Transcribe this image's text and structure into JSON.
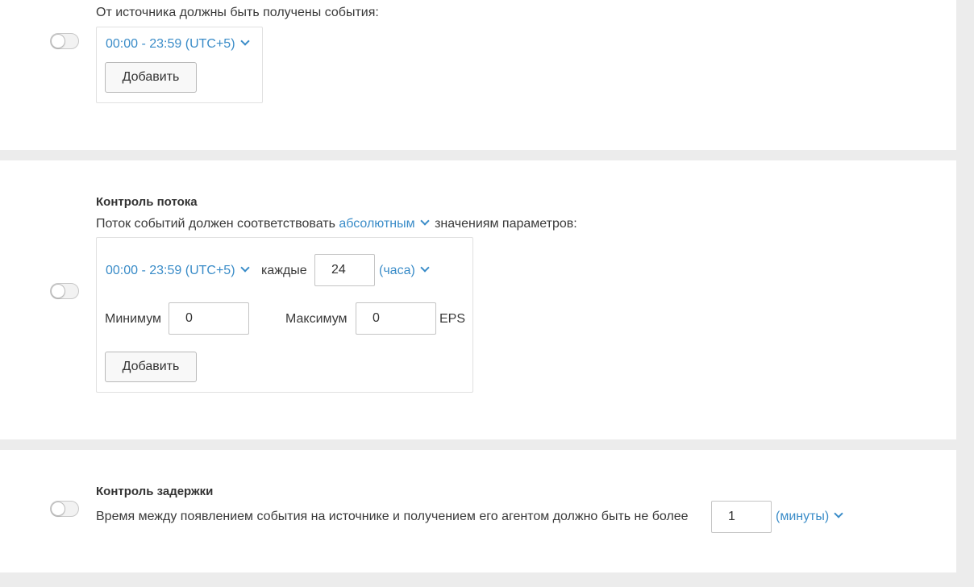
{
  "section1": {
    "label": "От источника должны быть получены события:",
    "time_range": "00:00 - 23:59 (UTC+5)",
    "add_button": "Добавить",
    "toggle_on": false
  },
  "section2": {
    "title": "Контроль потока",
    "desc_prefix": "Поток событий должен соответствовать",
    "mode": "абсолютным",
    "desc_suffix": "значениям параметров:",
    "time_range": "00:00 - 23:59 (UTC+5)",
    "every_label": "каждые",
    "every_value": "24",
    "unit": "(часа)",
    "min_label": "Минимум",
    "min_value": "0",
    "max_label": "Максимум",
    "max_value": "0",
    "eps_label": "EPS",
    "add_button": "Добавить",
    "toggle_on": false
  },
  "section3": {
    "title": "Контроль задержки",
    "desc": "Время между появлением события на источнике и получением его агентом должно быть не более",
    "delay_value": "1",
    "unit": "(минуты)",
    "toggle_on": false
  },
  "colors": {
    "accent": "#3a8cc8",
    "background": "#ececec",
    "card": "#ffffff"
  }
}
